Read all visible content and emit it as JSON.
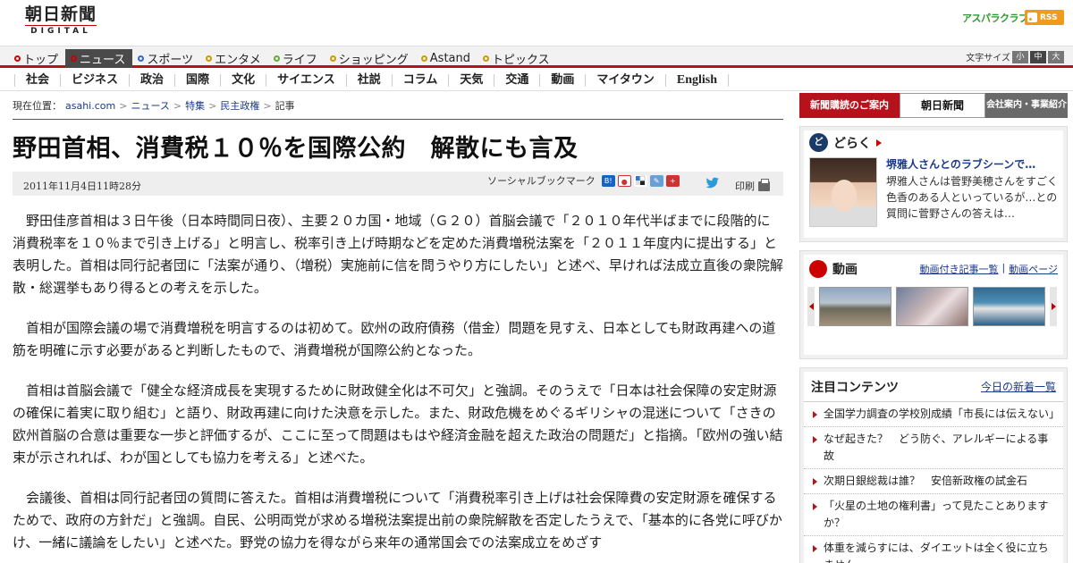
{
  "header": {
    "logo_main": "朝日新聞",
    "logo_sub": "DIGITAL",
    "asupara": "アスパラクラブ",
    "rss": "RSS"
  },
  "nav": {
    "items": [
      {
        "label": "トップ",
        "color": "#cc0000"
      },
      {
        "label": "ニュース",
        "color": "#cc0000"
      },
      {
        "label": "スポーツ",
        "color": "#3366cc"
      },
      {
        "label": "エンタメ",
        "color": "#cc9900"
      },
      {
        "label": "ライフ",
        "color": "#66aa33"
      },
      {
        "label": "ショッピング",
        "color": "#cc9900"
      },
      {
        "label": "Astand",
        "color": "#cc9900"
      },
      {
        "label": "トピックス",
        "color": "#cc9900"
      }
    ],
    "active_index": 1,
    "fontsize_label": "文字サイズ",
    "fontsize_options": [
      "小",
      "中",
      "大"
    ]
  },
  "subnav": {
    "items": [
      "社会",
      "ビジネス",
      "政治",
      "国際",
      "文化",
      "サイエンス",
      "社説",
      "コラム",
      "天気",
      "交通",
      "動画",
      "マイタウン",
      "English"
    ]
  },
  "breadcrumb": {
    "prefix": "現在位置：",
    "items": [
      "asahi.com",
      "ニュース",
      "特集",
      "民主政権",
      "記事"
    ]
  },
  "article": {
    "headline": "野田首相、消費税１０％を国際公約　解散にも言及",
    "date": "2011年11月4日11時28分",
    "social_label": "ソーシャルブックマーク",
    "print_label": "印刷",
    "paragraphs": [
      "野田佳彦首相は３日午後（日本時間同日夜）、主要２０カ国・地域（Ｇ２０）首脳会議で「２０１０年代半ばまでに段階的に消費税率を１０％まで引き上げる」と明言し、税率引き上げ時期などを定めた消費増税法案を「２０１１年度内に提出する」と表明した。首相は同行記者団に「法案が通り、（増税）実施前に信を問うやり方にしたい」と述べ、早ければ法成立直後の衆院解散・総選挙もあり得るとの考えを示した。",
      "首相が国際会議の場で消費増税を明言するのは初めて。欧州の政府債務（借金）問題を見すえ、日本としても財政再建への道筋を明確に示す必要があると判断したもので、消費増税が国際公約となった。",
      "首相は首脳会議で「健全な経済成長を実現するために財政健全化は不可欠」と強調。そのうえで「日本は社会保障の安定財源の確保に着実に取り組む」と語り、財政再建に向けた決意を示した。また、財政危機をめぐるギリシャの混迷について「さきの欧州首脳の合意は重要な一歩と評価するが、ここに至って問題はもはや経済金融を超えた政治の問題だ」と指摘。「欧州の強い結束が示されれば、わが国としても協力を考える」と述べた。",
      "会議後、首相は同行記者団の質問に答えた。首相は消費増税について「消費税率引き上げは社会保障費の安定財源を確保するためで、政府の方針だ」と強調。自民、公明両党が求める増税法案提出前の衆院解散を否定したうえで、「基本的に各党に呼びかけ、一緒に議論をしたい」と述べた。野党の協力を得ながら来年の通常国会での法案成立をめざす"
    ]
  },
  "sidebar": {
    "banner": {
      "subscribe": "新聞購読のご案内",
      "paper": "朝日新聞",
      "company": "会社案内・事業紹介"
    },
    "doraku": {
      "title": "どらく",
      "item_title": "堺雅人さんとのラブシーンで…",
      "item_text": "堺雅人さんは菅野美穂さんをすごく色香のある人といっているが…との質問に菅野さんの答えは…"
    },
    "video": {
      "title": "動画",
      "link1": "動画付き記事一覧",
      "separator": "|",
      "link2": "動画ページ"
    },
    "attention": {
      "title": "注目コンテンツ",
      "link": "今日の新着一覧",
      "items": [
        "全国学力調査の学校別成績「市長には伝えない」",
        "なぜ起きた？　どう防ぐ、アレルギーによる事故",
        "次期日銀総裁は誰？　安倍新政権の試金石",
        "「火星の土地の権利書」って見たことありますか？",
        "体重を減らすには、ダイエットは全く役に立ちません"
      ]
    }
  }
}
